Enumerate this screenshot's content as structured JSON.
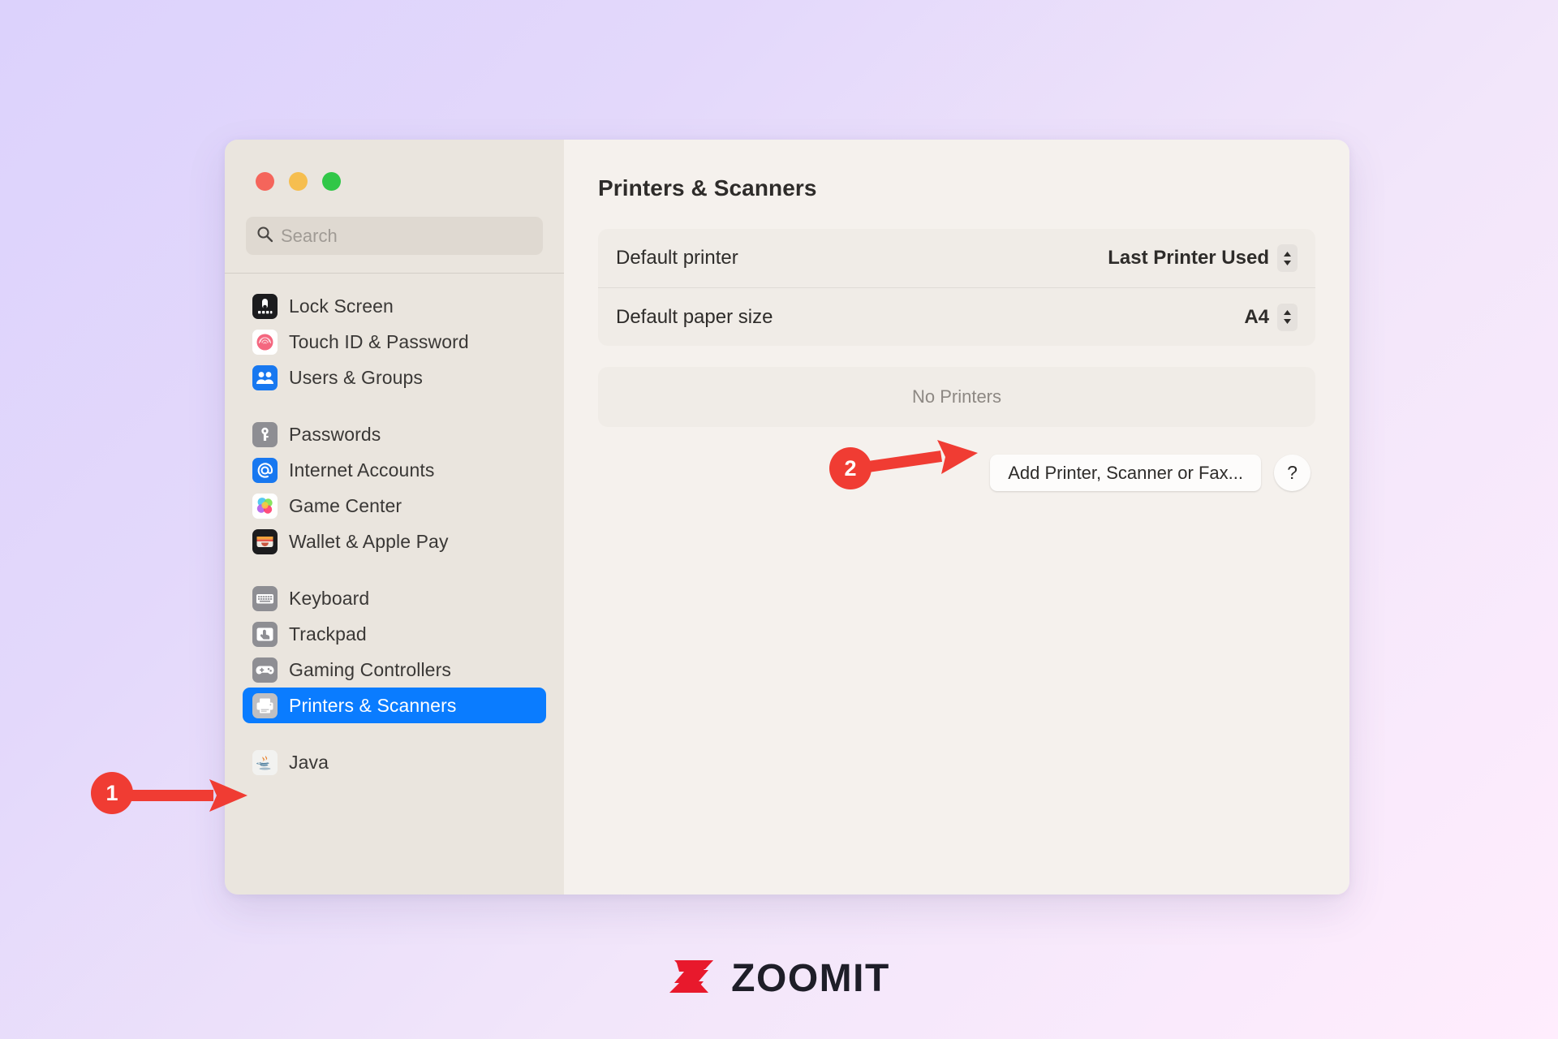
{
  "window": {
    "traffic_lights": [
      {
        "name": "close",
        "color": "#F5655B"
      },
      {
        "name": "minimize",
        "color": "#F6BE4F"
      },
      {
        "name": "maximize",
        "color": "#31C748"
      }
    ]
  },
  "search": {
    "placeholder": "Search",
    "value": "",
    "icon": "search-icon"
  },
  "sidebar": {
    "groups": [
      {
        "items": [
          {
            "label": "Lock Screen",
            "icon": "lock-screen-icon",
            "selected": false
          },
          {
            "label": "Touch ID & Password",
            "icon": "touch-id-icon",
            "selected": false
          },
          {
            "label": "Users & Groups",
            "icon": "users-groups-icon",
            "selected": false
          }
        ]
      },
      {
        "items": [
          {
            "label": "Passwords",
            "icon": "passwords-key-icon",
            "selected": false
          },
          {
            "label": "Internet Accounts",
            "icon": "internet-at-icon",
            "selected": false
          },
          {
            "label": "Game Center",
            "icon": "game-center-icon",
            "selected": false
          },
          {
            "label": "Wallet & Apple Pay",
            "icon": "wallet-icon",
            "selected": false
          }
        ]
      },
      {
        "items": [
          {
            "label": "Keyboard",
            "icon": "keyboard-icon",
            "selected": false
          },
          {
            "label": "Trackpad",
            "icon": "trackpad-icon",
            "selected": false
          },
          {
            "label": "Gaming Controllers",
            "icon": "gamepad-icon",
            "selected": false
          },
          {
            "label": "Printers & Scanners",
            "icon": "printer-icon",
            "selected": true
          }
        ]
      },
      {
        "items": [
          {
            "label": "Java",
            "icon": "java-icon",
            "selected": false
          }
        ]
      }
    ]
  },
  "main": {
    "title": "Printers & Scanners",
    "settings": [
      {
        "label": "Default printer",
        "value": "Last Printer Used",
        "control": "popup-stepper"
      },
      {
        "label": "Default paper size",
        "value": "A4",
        "control": "popup-stepper"
      }
    ],
    "printer_list_empty_text": "No Printers",
    "buttons": {
      "add": "Add Printer, Scanner or Fax...",
      "help": "?"
    }
  },
  "annotations": [
    {
      "number": "1",
      "target": "sidebar-item-printers-scanners",
      "color": "#F03C33"
    },
    {
      "number": "2",
      "target": "add-printer-button",
      "color": "#F03C33"
    }
  ],
  "branding": {
    "logo_text": "ZOOMIT",
    "logo_mark": "z-mark",
    "mark_color": "#E8192C",
    "text_color": "#1E1E28"
  },
  "theme": {
    "background_start": "#DCD2FC",
    "background_end": "#FFEDFD",
    "sidebar_bg": "#EAE5DE",
    "main_bg": "#F5F1ED",
    "card_bg": "#F0ECE7",
    "accent_selected": "#0A7CFF"
  }
}
